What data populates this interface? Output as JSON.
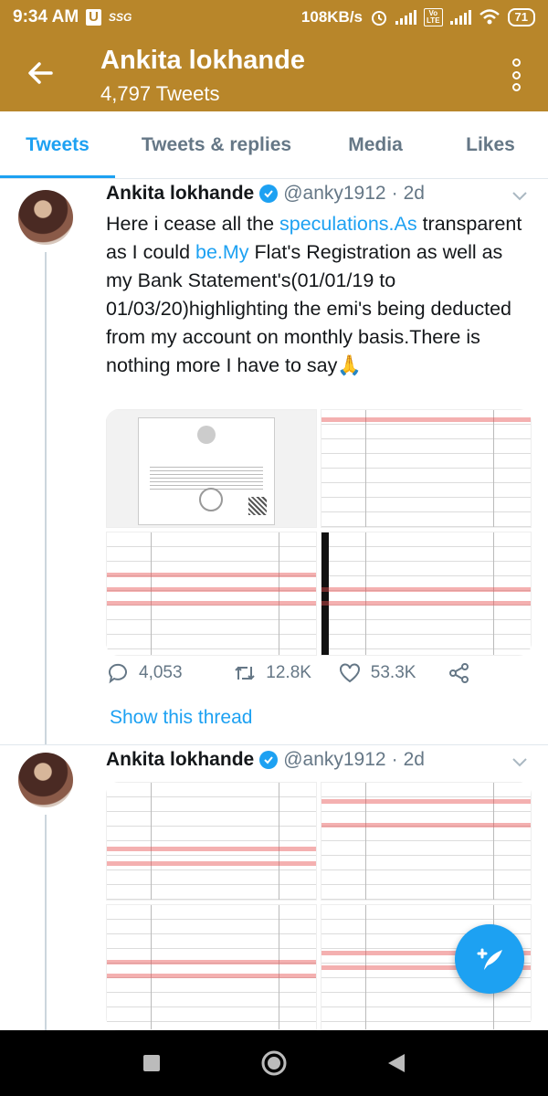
{
  "status_bar": {
    "time": "9:34 AM",
    "u_badge": "U",
    "carrier_tag": "SSG",
    "speed": "108KB/s",
    "volte": "Vo\nLTE",
    "battery": "71"
  },
  "header": {
    "title": "Ankita lokhande",
    "subtitle": "4,797 Tweets",
    "back_icon": "arrow-left-icon",
    "more_icon": "more-vertical-icon"
  },
  "tabs": [
    {
      "label": "Tweets",
      "active": true
    },
    {
      "label": "Tweets & replies",
      "active": false
    },
    {
      "label": "Media",
      "active": false
    },
    {
      "label": "Likes",
      "active": false
    }
  ],
  "tweets": [
    {
      "name": "Ankita lokhande",
      "handle": "@anky1912",
      "dot": "·",
      "time": "2d",
      "text_parts": {
        "p1": "Here i cease all the ",
        "l1": "speculations.As",
        "p2": " transparent as I could ",
        "l2": "be.My",
        "p3": " Flat's Registration as well as my Bank Statement's(01/01/19 to 01/03/20)highlighting the emi's being deducted from my account on monthly basis.There is nothing more I have to say🙏"
      },
      "media_description": [
        "stamp-paper-document",
        "bank-statement-1",
        "bank-statement-2",
        "bank-statement-3"
      ],
      "actions": {
        "replies": "4,053",
        "retweets": "12.8K",
        "likes": "53.3K"
      },
      "show_thread": "Show this thread"
    },
    {
      "name": "Ankita lokhande",
      "handle": "@anky1912",
      "dot": "·",
      "time": "2d",
      "media_description": [
        "bank-statement-4",
        "bank-statement-5",
        "bank-statement-6",
        "bank-statement-7"
      ]
    }
  ],
  "colors": {
    "header_bg": "#b8862a",
    "accent": "#1da1f2",
    "secondary_text": "#657786"
  },
  "fab_icon": "compose-tweet-icon",
  "nav": [
    "recent-apps-icon",
    "home-icon",
    "back-icon"
  ]
}
